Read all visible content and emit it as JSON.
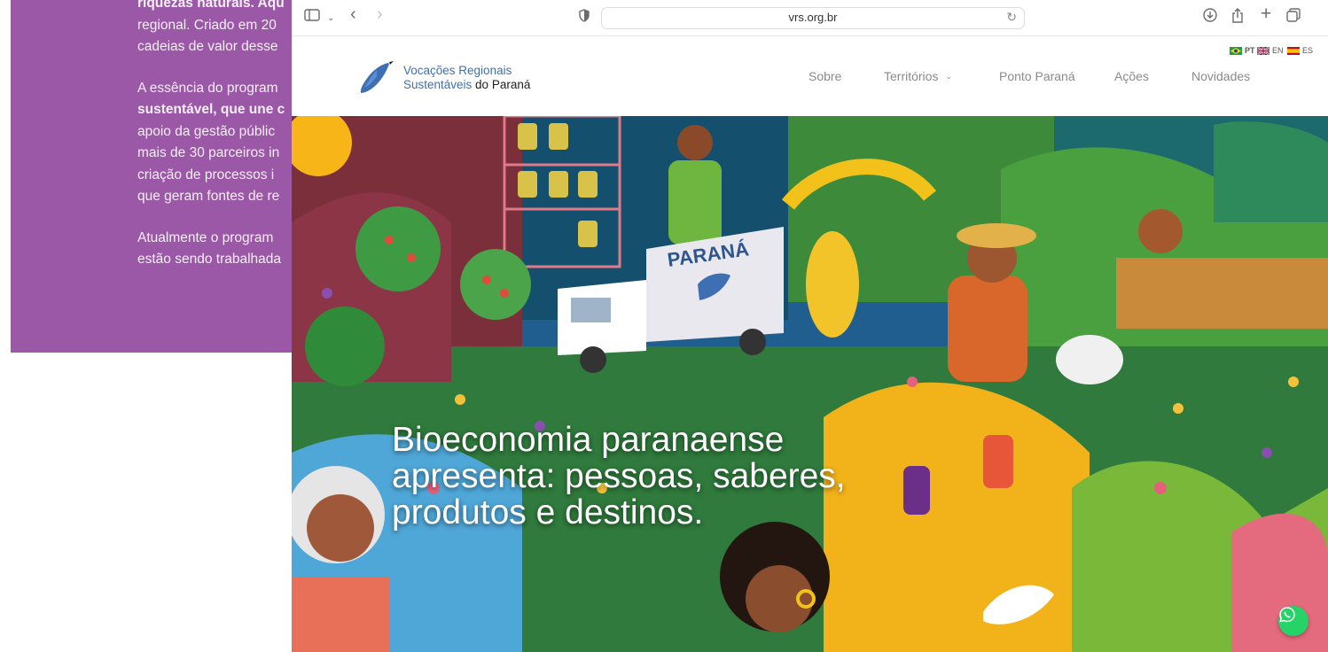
{
  "background_page": {
    "paragraphs": [
      [
        "riquezas naturais. Aqu",
        "regional. Criado em 20",
        "cadeias de valor desse"
      ],
      [
        "A essência do program",
        "sustentável, que une c",
        "apoio da gestão públic",
        "mais de 30 parceiros in",
        "criação de processos i",
        "que geram fontes de re"
      ],
      [
        "Atualmente o program",
        "estão sendo trabalhada"
      ]
    ]
  },
  "browser": {
    "url": "vrs.org.br",
    "icons": {
      "sidebar": "sidebar-icon",
      "back": "back-icon",
      "forward": "forward-icon",
      "shield": "shield-icon",
      "reload": "reload-icon",
      "download": "download-icon",
      "share": "share-icon",
      "new_tab": "plus-icon",
      "tabs": "tabs-icon"
    }
  },
  "site": {
    "logo_line1": "Vocações Regionais",
    "logo_line2_a": "Sustentáveis ",
    "logo_line2_b": "do Paraná",
    "languages": [
      {
        "code": "PT",
        "flag": "brazil-flag"
      },
      {
        "code": "EN",
        "flag": "uk-flag"
      },
      {
        "code": "ES",
        "flag": "spain-flag"
      }
    ],
    "nav": [
      "Sobre",
      "Territórios",
      "Ponto Paraná",
      "Ações",
      "Novidades"
    ],
    "nav_dropdown_icon": "chevron-down-icon",
    "hero_title": "Bioeconomia paranaense apresenta: pessoas, saberes, produtos e destinos.",
    "hero_truck_label": "PARANÁ",
    "whatsapp_icon": "whatsapp-icon"
  },
  "colors": {
    "purple": "#9b58a6",
    "logo_blue": "#3e6fb3",
    "whatsapp": "#25d366"
  }
}
